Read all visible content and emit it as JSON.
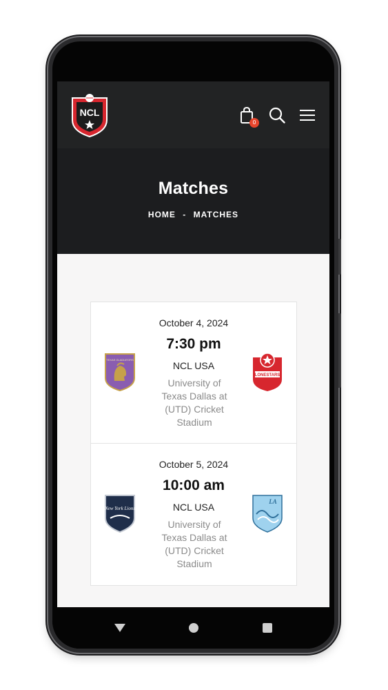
{
  "header": {
    "logo_text": "NCL",
    "cart_count": "0"
  },
  "hero": {
    "title": "Matches",
    "breadcrumb_home": "HOME",
    "breadcrumb_sep": "-",
    "breadcrumb_current": "MATCHES"
  },
  "matches": [
    {
      "date": "October 4, 2024",
      "time": "7:30 pm",
      "league": "NCL USA",
      "venue": "University of Texas Dallas at (UTD) Cricket Stadium",
      "home_logo_text": "TEXAS GLADIATORS",
      "away_logo_text": "LONESTARS"
    },
    {
      "date": "October 5, 2024",
      "time": "10:00 am",
      "league": "NCL USA",
      "venue": "University of Texas Dallas at (UTD) Cricket Stadium",
      "home_logo_text": "New York Lions",
      "away_logo_text": "LA"
    }
  ],
  "icons": {
    "cart": "shopping-bag-icon",
    "search": "search-icon",
    "menu": "hamburger-menu-icon",
    "nav_back": "back-triangle-icon",
    "nav_home": "home-circle-icon",
    "nav_recent": "recent-square-icon"
  },
  "colors": {
    "header_bg": "#222324",
    "hero_bg": "#1c1d1f",
    "accent_red": "#e8452c",
    "logo_red": "#d7262e"
  }
}
